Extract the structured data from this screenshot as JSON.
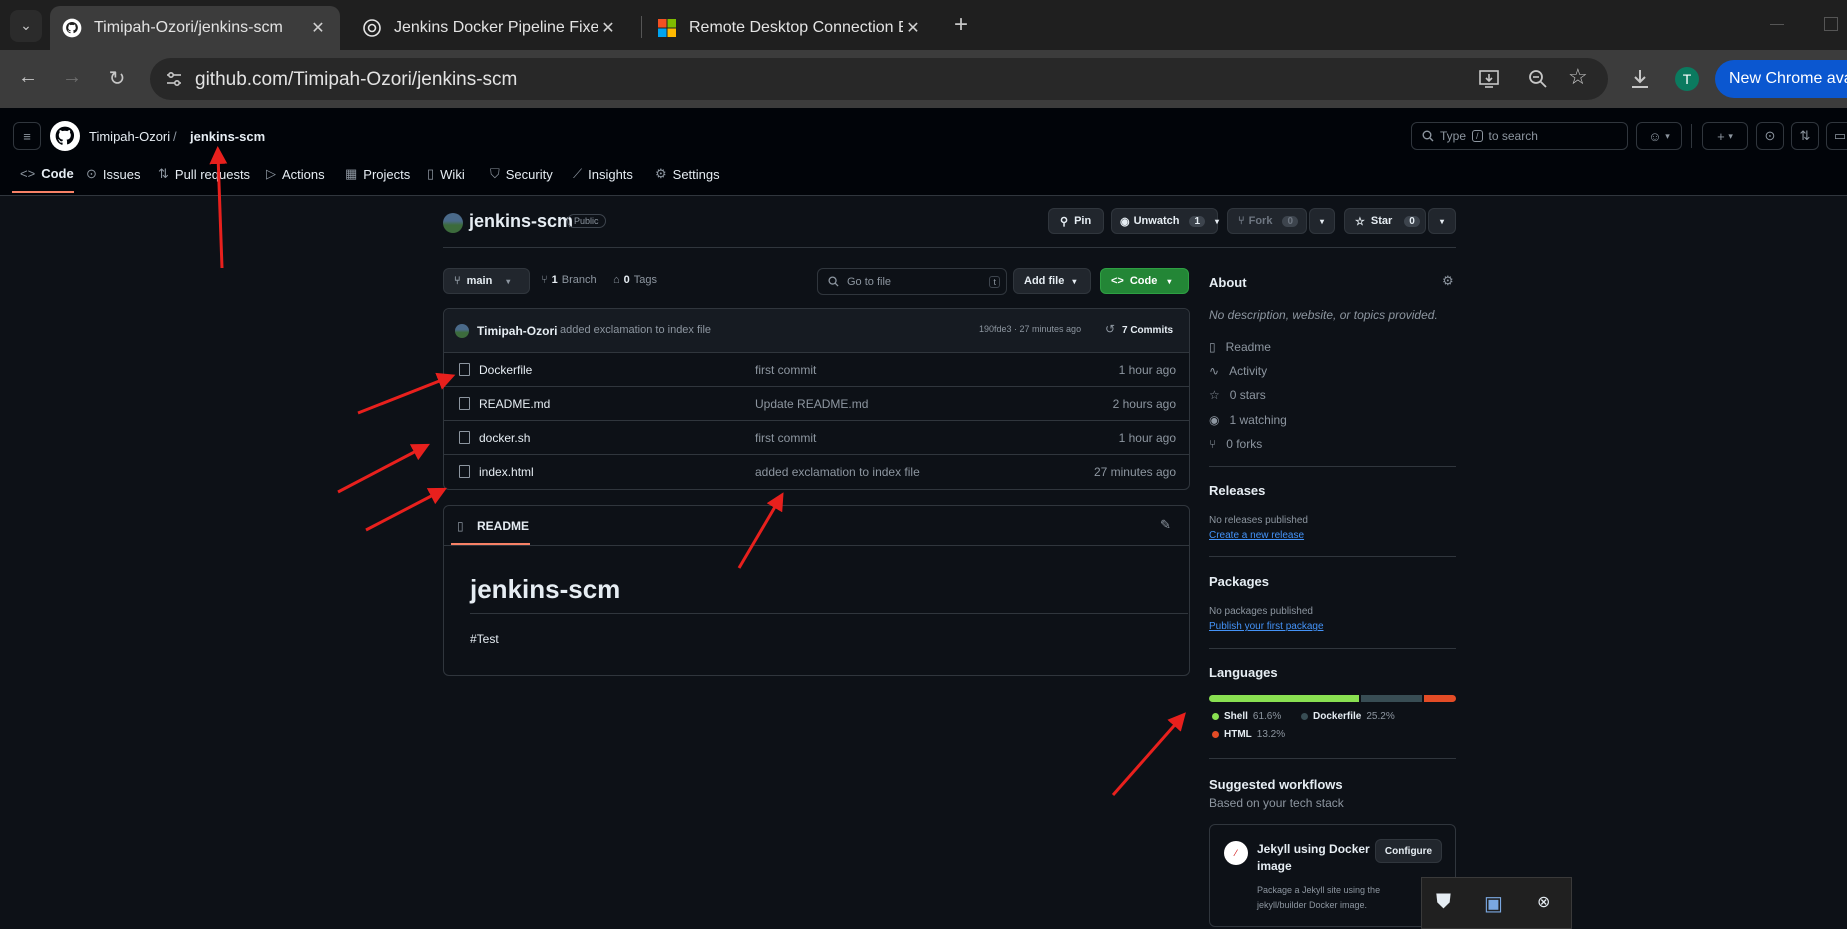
{
  "browser": {
    "tabs": [
      {
        "title": "Timipah-Ozori/jenkins-scm",
        "icon": "github-icon"
      },
      {
        "title": "Jenkins Docker Pipeline Fixes",
        "icon": "chatgpt-icon"
      },
      {
        "title": "Remote Desktop Connection Er",
        "icon": "microsoft-icon"
      }
    ],
    "url": "github.com/Timipah-Ozori/jenkins-scm",
    "profile_initial": "T",
    "new_chrome_label": "New Chrome avai"
  },
  "header": {
    "owner": "Timipah-Ozori",
    "separator": "/",
    "repo": "jenkins-scm",
    "search_placeholder": "Type / to search",
    "search_key": "/",
    "search_prefix": "Type",
    "search_suffix": "to search"
  },
  "repo_nav": [
    "Code",
    "Issues",
    "Pull requests",
    "Actions",
    "Projects",
    "Wiki",
    "Security",
    "Insights",
    "Settings"
  ],
  "repo": {
    "name": "jenkins-scm",
    "visibility": "Public",
    "pin": "Pin",
    "unwatch": "Unwatch",
    "watch_count": "1",
    "fork": "Fork",
    "fork_count": "0",
    "star": "Star",
    "star_count": "0"
  },
  "branch_bar": {
    "branch": "main",
    "branches_count": "1",
    "branches_label": "Branch",
    "tags_count": "0",
    "tags_label": "Tags",
    "goto_placeholder": "Go to file",
    "goto_key": "t",
    "add_file": "Add file",
    "code": "Code"
  },
  "commit": {
    "author": "Timipah-Ozori",
    "message": "added exclamation to index file",
    "hash_time": "190fde3 · 27 minutes ago",
    "commits": "7 Commits"
  },
  "files": [
    {
      "name": "Dockerfile",
      "message": "first commit",
      "time": "1 hour ago"
    },
    {
      "name": "README.md",
      "message": "Update README.md",
      "time": "2 hours ago"
    },
    {
      "name": "docker.sh",
      "message": "first commit",
      "time": "1 hour ago"
    },
    {
      "name": "index.html",
      "message": "added exclamation to index file",
      "time": "27 minutes ago"
    }
  ],
  "readme": {
    "tab": "README",
    "heading": "jenkins-scm",
    "body": "#Test"
  },
  "about": {
    "title": "About",
    "description": "No description, website, or topics provided.",
    "items": [
      "Readme",
      "Activity",
      "0 stars",
      "1 watching",
      "0 forks"
    ]
  },
  "releases": {
    "title": "Releases",
    "none": "No releases published",
    "link": "Create a new release"
  },
  "packages": {
    "title": "Packages",
    "none": "No packages published",
    "link": "Publish your first package"
  },
  "languages": {
    "title": "Languages",
    "items": [
      {
        "name": "Shell",
        "percent": "61.6%",
        "value": 61.6,
        "color": "#89e051"
      },
      {
        "name": "Dockerfile",
        "percent": "25.2%",
        "value": 25.2,
        "color": "#384d54"
      },
      {
        "name": "HTML",
        "percent": "13.2%",
        "value": 13.2,
        "color": "#e34c26"
      }
    ]
  },
  "workflows": {
    "title": "Suggested workflows",
    "subtitle": "Based on your tech stack",
    "card_title": "Jekyll using Docker image",
    "card_desc": "Package a Jekyll site using the jekyll/builder Docker image.",
    "configure": "Configure"
  },
  "colors": {
    "annotation_arrow": "#e8201d",
    "accent_orange": "#f78166",
    "green_button": "#238636",
    "link": "#4493f8"
  }
}
